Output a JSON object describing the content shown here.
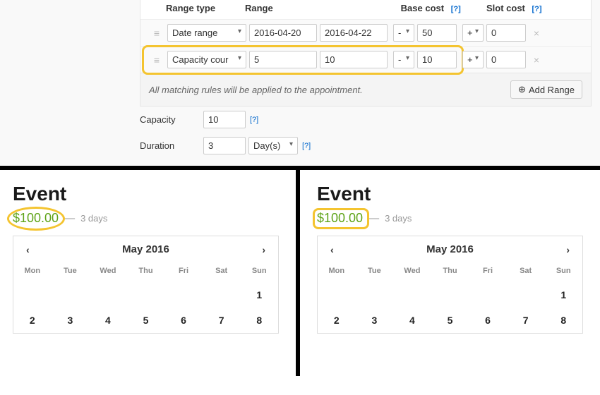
{
  "headers": {
    "range_type": "Range type",
    "range": "Range",
    "base_cost": "Base cost",
    "slot_cost": "Slot cost",
    "help": "[?]"
  },
  "rows": [
    {
      "type": "Date range",
      "from": "2016-04-20",
      "to": "2016-04-22",
      "base_sign": "-",
      "base_val": "50",
      "slot_sign": "+",
      "slot_val": "0"
    },
    {
      "type": "Capacity cour",
      "from": "5",
      "to": "10",
      "base_sign": "-",
      "base_val": "10",
      "slot_sign": "+",
      "slot_val": "0"
    }
  ],
  "footer_note": "All matching rules will be applied to the appointment.",
  "add_range_label": "Add Range",
  "capacity": {
    "label": "Capacity",
    "value": "10"
  },
  "duration": {
    "label": "Duration",
    "value": "3",
    "unit": "Day(s)"
  },
  "event_left": {
    "title": "Event",
    "price": "$100.00",
    "dash": "—",
    "days": "3 days"
  },
  "event_right": {
    "title": "Event",
    "price": "$100.00",
    "dash": "—",
    "days": "3 days"
  },
  "calendar": {
    "title": "May 2016",
    "prev": "‹",
    "next": "›",
    "dow": [
      "Mon",
      "Tue",
      "Wed",
      "Thu",
      "Fri",
      "Sat",
      "Sun"
    ],
    "row1": [
      "",
      "",
      "",
      "",
      "",
      "",
      "1"
    ],
    "row2": [
      "2",
      "3",
      "4",
      "5",
      "6",
      "7",
      "8"
    ]
  }
}
